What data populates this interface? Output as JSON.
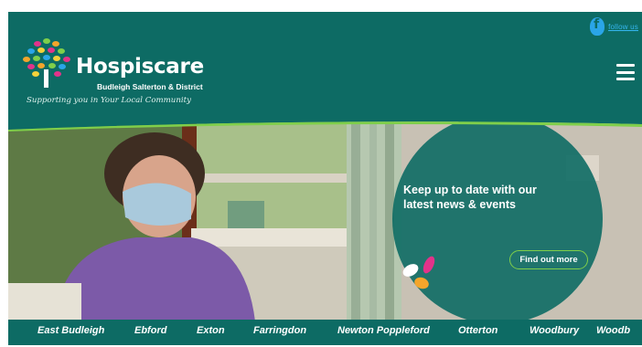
{
  "header": {
    "follow_label": "follow us",
    "brand_name": "Hospiscare",
    "brand_sub": "Budleigh Salterton & District",
    "tagline": "Supporting you in Your Local Community"
  },
  "promo": {
    "title": "Keep up to date with our latest news & events",
    "button_label": "Find out more"
  },
  "villages": [
    "East Budleigh",
    "Ebford",
    "Exton",
    "Farringdon",
    "Newton Poppleford",
    "Otterton",
    "Woodbury",
    "Woodb"
  ],
  "colors": {
    "brand_teal": "#0d6b64",
    "accent_green": "#7fcf4a",
    "link_blue": "#35b6f0"
  },
  "icons": [
    "facebook-icon",
    "menu-icon",
    "tree-logo-icon",
    "petals-icon"
  ]
}
